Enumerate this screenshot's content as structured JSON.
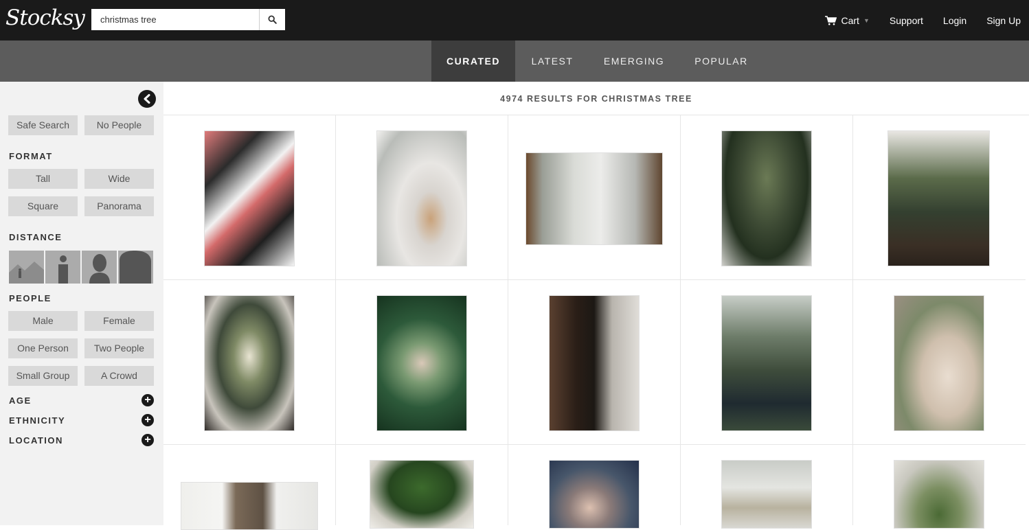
{
  "header": {
    "logo": "Stocksy",
    "search": {
      "value": "christmas tree",
      "placeholder": ""
    },
    "nav": {
      "cart": "Cart",
      "support": "Support",
      "login": "Login",
      "signup": "Sign Up"
    }
  },
  "tabs": [
    {
      "label": "CURATED",
      "active": true
    },
    {
      "label": "LATEST",
      "active": false
    },
    {
      "label": "EMERGING",
      "active": false
    },
    {
      "label": "POPULAR",
      "active": false
    }
  ],
  "sidebar": {
    "top_filters": [
      "Safe Search",
      "No People"
    ],
    "format": {
      "title": "FORMAT",
      "options": [
        "Tall",
        "Wide",
        "Square",
        "Panorama"
      ]
    },
    "distance": {
      "title": "DISTANCE",
      "options": [
        "distance-far-icon",
        "distance-medium-icon",
        "distance-close-icon",
        "distance-extreme-close-icon"
      ]
    },
    "people": {
      "title": "PEOPLE",
      "options": [
        "Male",
        "Female",
        "One Person",
        "Two People",
        "Small Group",
        "A Crowd"
      ]
    },
    "collapsibles": [
      "AGE",
      "ETHNICITY",
      "LOCATION"
    ]
  },
  "results": {
    "text": "4974 RESULTS FOR CHRISTMAS TREE"
  },
  "colors": {
    "header_bg": "#1a1a1a",
    "tabbar_bg": "#5c5c5c",
    "tab_active_bg": "#3d3d3d",
    "sidebar_bg": "#f2f2f2",
    "filter_btn_bg": "#d9d9d9"
  },
  "photos": [
    {
      "name": "photo-gift-boxes",
      "background": "linear-gradient(135deg, #e07b7b 0%, #2b2b2b 25%, #f2f2f2 45%, #d46a6a 55%, #1f1f1f 75%, #f5f5f5 100%)"
    },
    {
      "name": "photo-snow-globe-deer",
      "background": "radial-gradient(ellipse at 60% 65%, #c9a27a 0%, #d8d4cf 22%, #e8e6e3 45%, #b9bcb8 80%, #f2f1ef 100%)"
    },
    {
      "name": "photo-dining-room",
      "background": "linear-gradient(90deg, #6b4a2e 0%, #9a9e96 12%, #d9dbd6 35%, #ececea 55%, #b6b8b4 80%, #5f4630 100%)"
    },
    {
      "name": "photo-tree-with-cake",
      "background": "radial-gradient(ellipse at 50% 35%, #6b7a55 0%, #3d4a34 40%, #23301f 65%, #cfcfca 100%)"
    },
    {
      "name": "photo-couple-decorating",
      "background": "linear-gradient(180deg, #e9e7e3 0%, #5b6b4a 35%, #344030 60%, #3a2f25 85%, #2a221c 100%)"
    },
    {
      "name": "photo-girl-holding-tree",
      "background": "radial-gradient(ellipse at 50% 45%, #e8e4d2 0%, #7f8a65 25%, #3f4a3a 50%, #c8c4bc 75%, #2e2a27 100%)"
    },
    {
      "name": "photo-jar-deer",
      "background": "radial-gradient(circle at 50% 50%, #d9c8b8 0%, #7a9a72 25%, #2d5a3a 55%, #16331f 100%)"
    },
    {
      "name": "photo-tree-in-barn",
      "background": "linear-gradient(90deg, #5a4030 0%, #2a1e17 30%, #1c1814 50%, #b8b4ad 70%, #e0ddd8 100%)"
    },
    {
      "name": "photo-couple-in-car",
      "background": "linear-gradient(180deg, #c7cdc7 0%, #6e7d6a 30%, #3f4d3c 55%, #1f2a30 80%, #3a4a3a 100%)"
    },
    {
      "name": "photo-wrapped-gifts",
      "background": "radial-gradient(ellipse at 60% 60%, #e9ddd0 0%, #cfbfad 35%, #7d8a6a 65%, #9a8f82 100%)"
    },
    {
      "name": "photo-barn-doors-wreaths",
      "background": "linear-gradient(90deg, #efefec 0%, #f5f5f3 30%, #7b6a58 40%, #5e5144 60%, #f0f0ee 70%, #e6e6e3 100%)"
    },
    {
      "name": "photo-decorating-tree",
      "background": "radial-gradient(ellipse at 50% 40%, #3c6a2c 0%, #26461f 45%, #d2cfc6 75%, #f0eee9 100%)"
    },
    {
      "name": "photo-woman-ornament",
      "background": "radial-gradient(ellipse at 45% 70%, #dcc0b0 0%, #8a7a78 30%, #47566a 60%, #24304a 100%)"
    },
    {
      "name": "photo-wall-tree",
      "background": "linear-gradient(180deg, #c9ccc7 0%, #e4e5e1 40%, #b8b29f 70%, #d9d8d2 100%)"
    },
    {
      "name": "photo-small-tree-porch",
      "background": "radial-gradient(ellipse at 50% 80%, #4b6a35 0%, #7c8f62 35%, #c8c7be 70%, #e3e1db 100%)"
    }
  ]
}
